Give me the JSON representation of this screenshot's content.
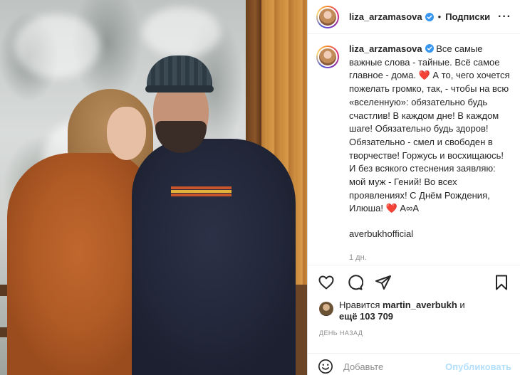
{
  "post": {
    "author": "liza_arzamasova",
    "separator": "•",
    "follow_label": "Подписки",
    "more_label": "···",
    "caption_author": "liza_arzamasova",
    "caption_lines": [
      "Все самые",
      "важные слова - тайные. Всё самое",
      "главное - дома.",
      "А то, чего",
      "хочется пожелать громко, так, -",
      "чтобы на всю «вселенную»:",
      "обязательно будь счастлив! В",
      "каждом дне! В каждом шаге!",
      "Обязательно будь здоров!",
      "Обязательно - смел и свободен в",
      "творчестве! Горжусь и восхищаюсь!",
      "И без всякого стеснения заявляю:",
      "мой муж - Гений! Во всех",
      "проявлениях! С Днём Рождения,",
      "Илюша!",
      "А∞А"
    ],
    "heart": "❤️",
    "tagged_user": "averbukhofficial",
    "time_ago": "1 дн.",
    "likes_prefix": "Нравится",
    "likes_user": "martin_averbukh",
    "likes_conj": "и",
    "likes_more": "ещё 103 709",
    "date_label": "ДЕНЬ НАЗАД",
    "comment_placeholder": "Добавьте",
    "publish_label": "Опубликовать"
  },
  "icons": {
    "heart": "heart-icon",
    "comment": "comment-icon",
    "share": "share-icon",
    "bookmark": "bookmark-icon",
    "emoji": "emoji-icon",
    "verified": "verified-badge-icon"
  },
  "colors": {
    "verified": "#3897f0",
    "heart": "#ed1b24",
    "publish_disabled": "#b2dffc",
    "meta": "#8e8e8e"
  }
}
